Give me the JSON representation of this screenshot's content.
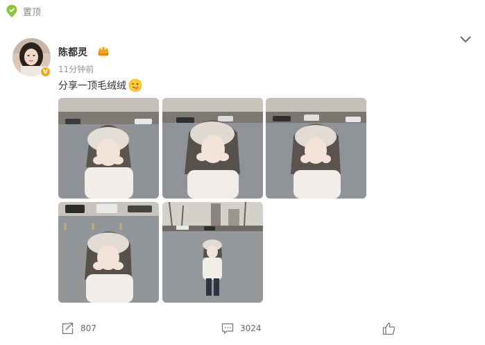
{
  "pinned": {
    "label": "置顶",
    "icon": "pin-location-icon"
  },
  "post": {
    "author": "陈都灵",
    "timestamp": "11分钟前",
    "text": "分享一顶毛绒绒",
    "emoji": "wink-tongue-emoji-icon",
    "verified_badge": "V"
  },
  "photos": [
    {
      "alt": "photo-1"
    },
    {
      "alt": "photo-2"
    },
    {
      "alt": "photo-3"
    },
    {
      "alt": "photo-4"
    },
    {
      "alt": "photo-5"
    }
  ],
  "actions": {
    "repost_count": "807",
    "comment_count": "3024"
  },
  "colors": {
    "accent_green": "#8cc63f",
    "badge_orange": "#f5a623",
    "text_gray": "#939393"
  }
}
